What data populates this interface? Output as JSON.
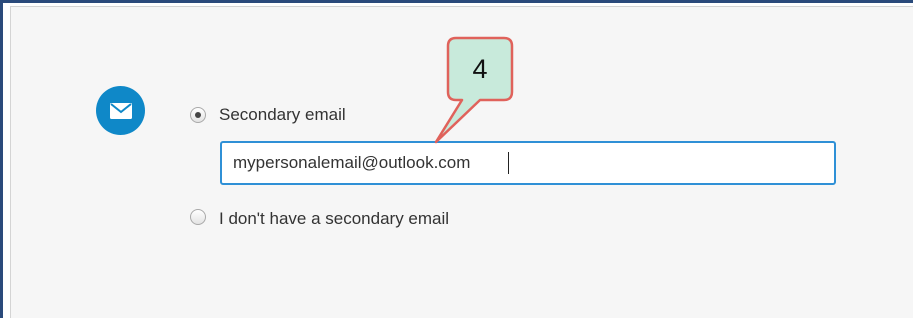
{
  "form": {
    "icon": "envelope-icon",
    "accent_color": "#0f88c8",
    "options": [
      {
        "label": "Secondary email",
        "selected": true
      },
      {
        "label": "I don't have a secondary email",
        "selected": false
      }
    ],
    "email_input": {
      "value": "mypersonalemail@outlook.com"
    }
  },
  "annotation": {
    "step_number": "4",
    "fill_color": "#c8eadb",
    "border_color": "#e0625b"
  }
}
